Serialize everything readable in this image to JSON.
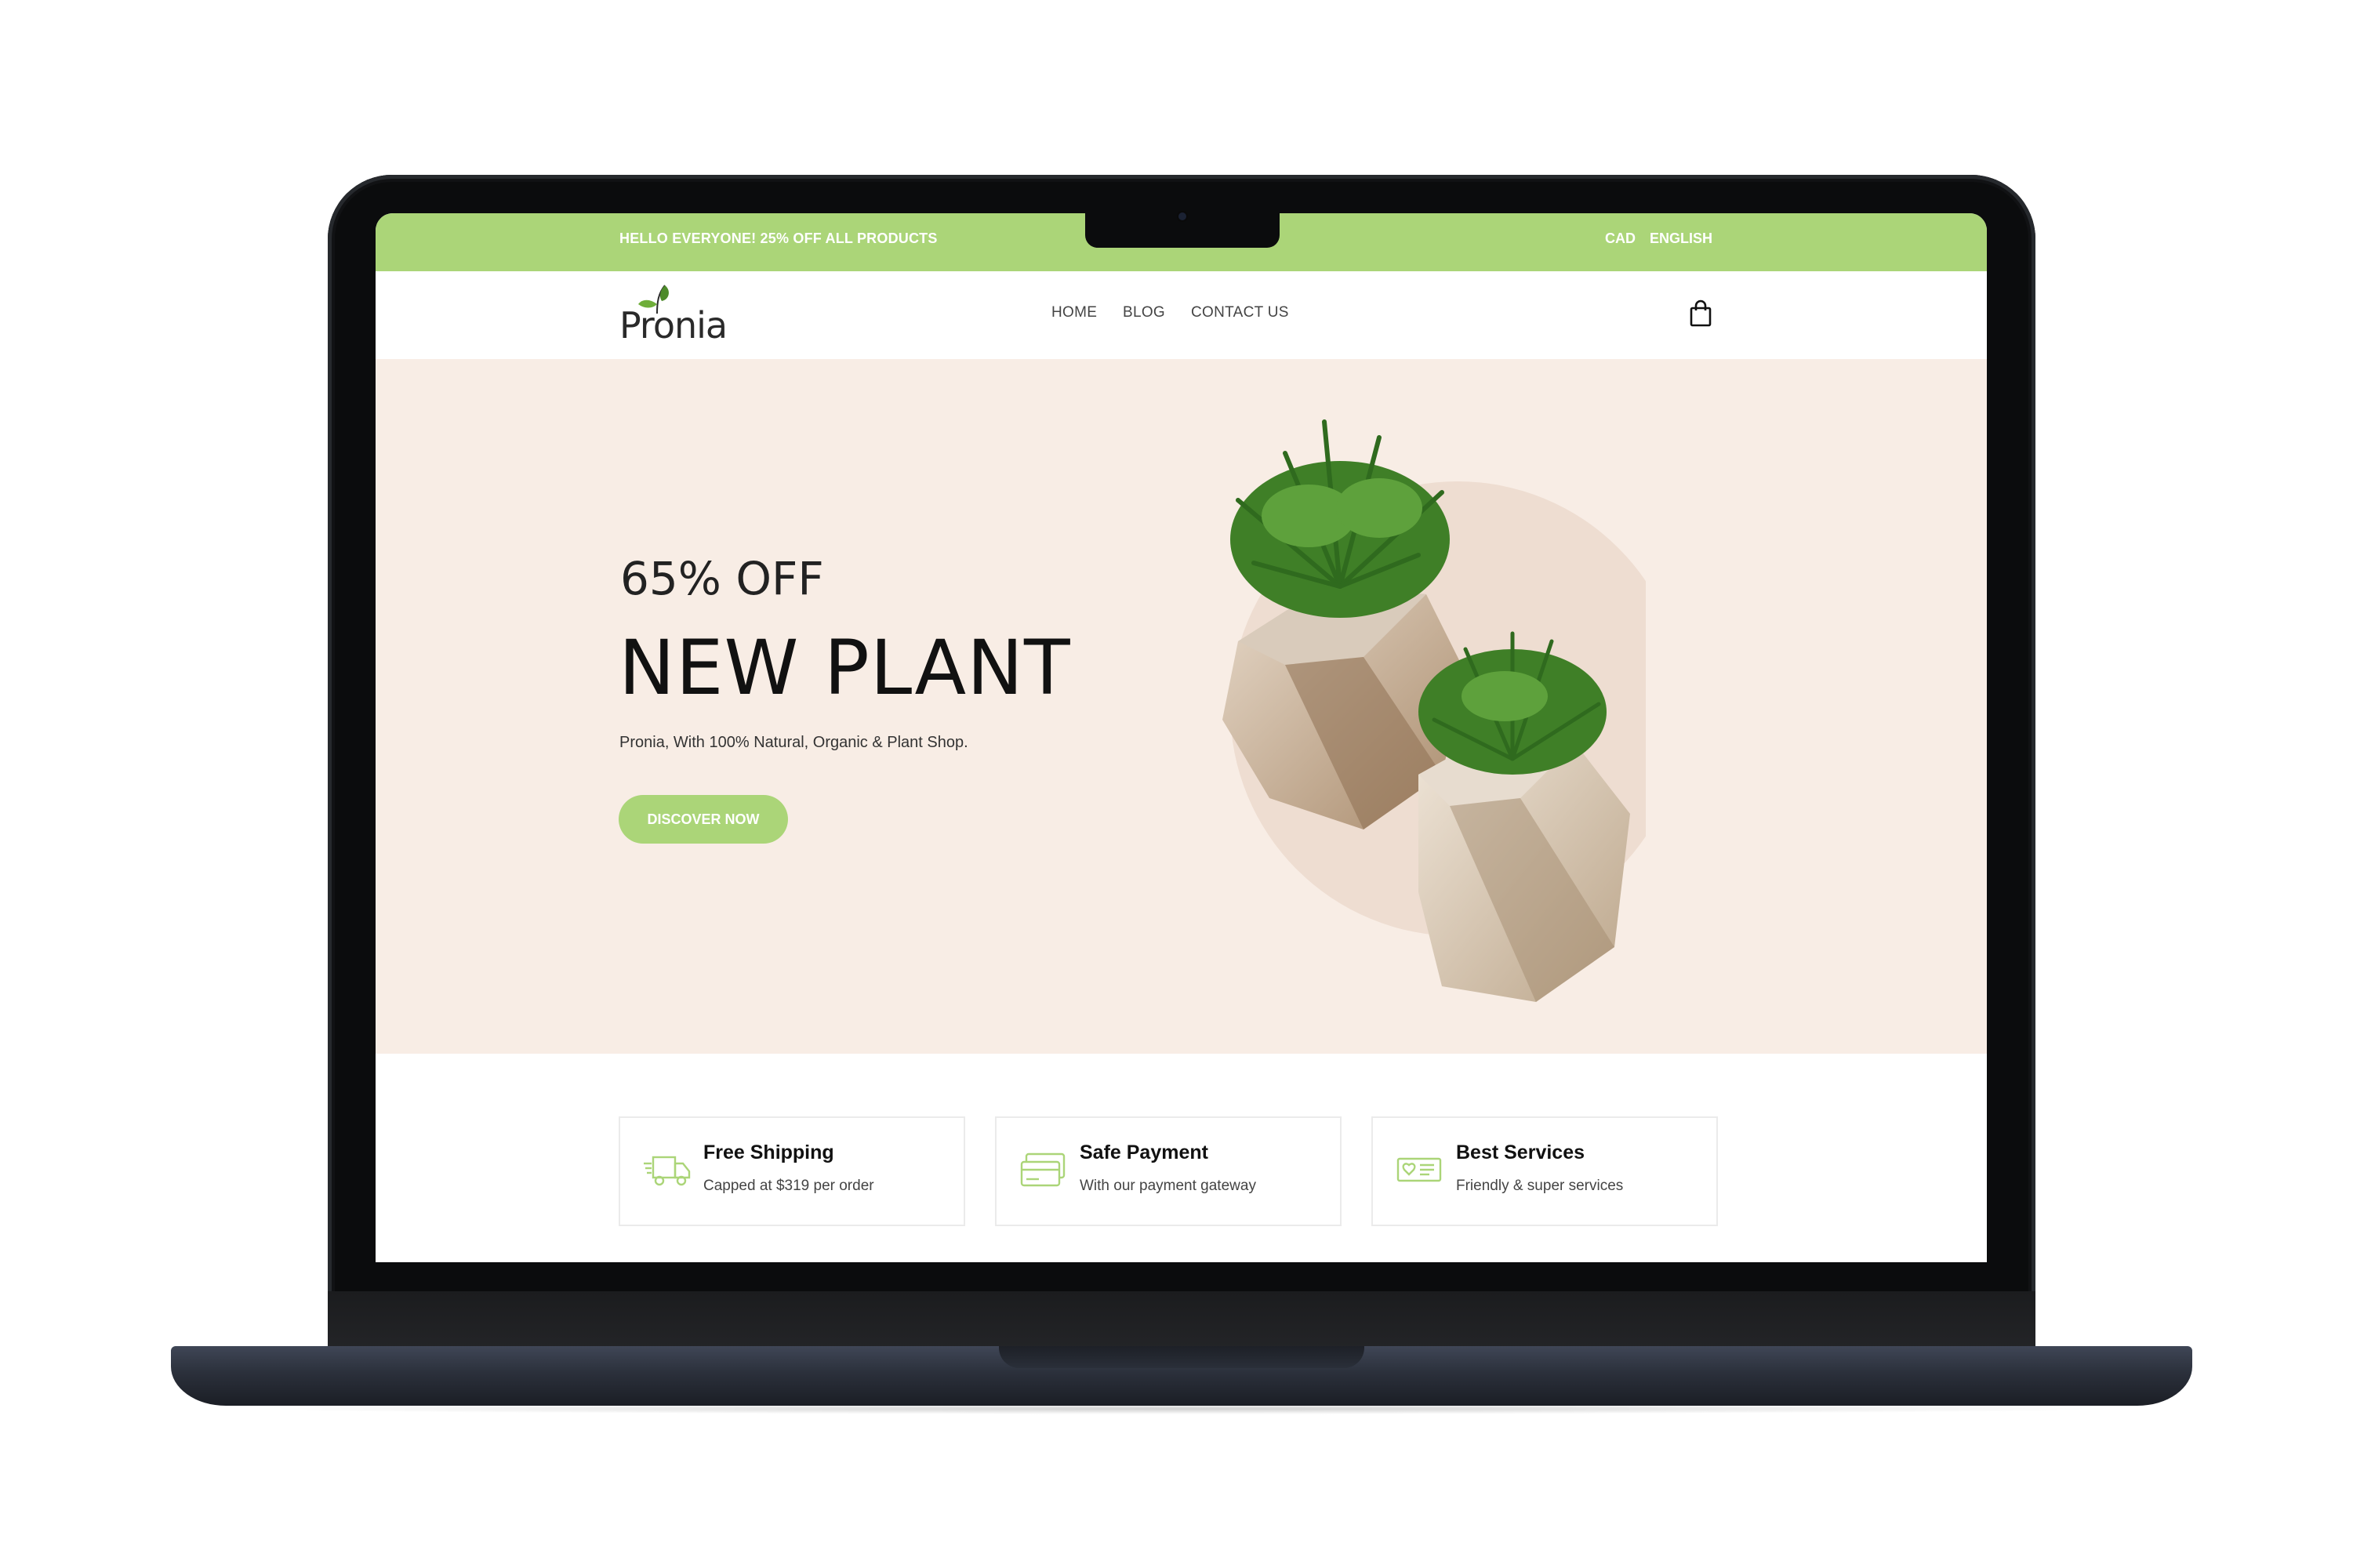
{
  "topbar": {
    "promo": "HELLO EVERYONE! 25% OFF ALL PRODUCTS",
    "currency": "CAD",
    "language": "ENGLISH"
  },
  "brand": {
    "logo_text": "Pronia"
  },
  "nav": {
    "items": [
      {
        "label": "HOME"
      },
      {
        "label": "BLOG"
      },
      {
        "label": "CONTACT US"
      }
    ],
    "cart_icon": "shopping-bag-icon"
  },
  "hero": {
    "subtitle": "65% OFF",
    "title": "NEW PLANT",
    "description": "Pronia, With 100% Natural, Organic & Plant Shop.",
    "cta_label": "DISCOVER NOW",
    "image": "potted-plants-illustration"
  },
  "features": [
    {
      "icon": "truck-icon",
      "title": "Free Shipping",
      "desc": "Capped at $319 per order"
    },
    {
      "icon": "credit-card-icon",
      "title": "Safe Payment",
      "desc": "With our payment gateway"
    },
    {
      "icon": "service-icon",
      "title": "Best Services",
      "desc": "Friendly & super services"
    }
  ],
  "colors": {
    "accent": "#abd578",
    "hero_bg": "#f8ede5",
    "device": "#0b0c0d"
  }
}
